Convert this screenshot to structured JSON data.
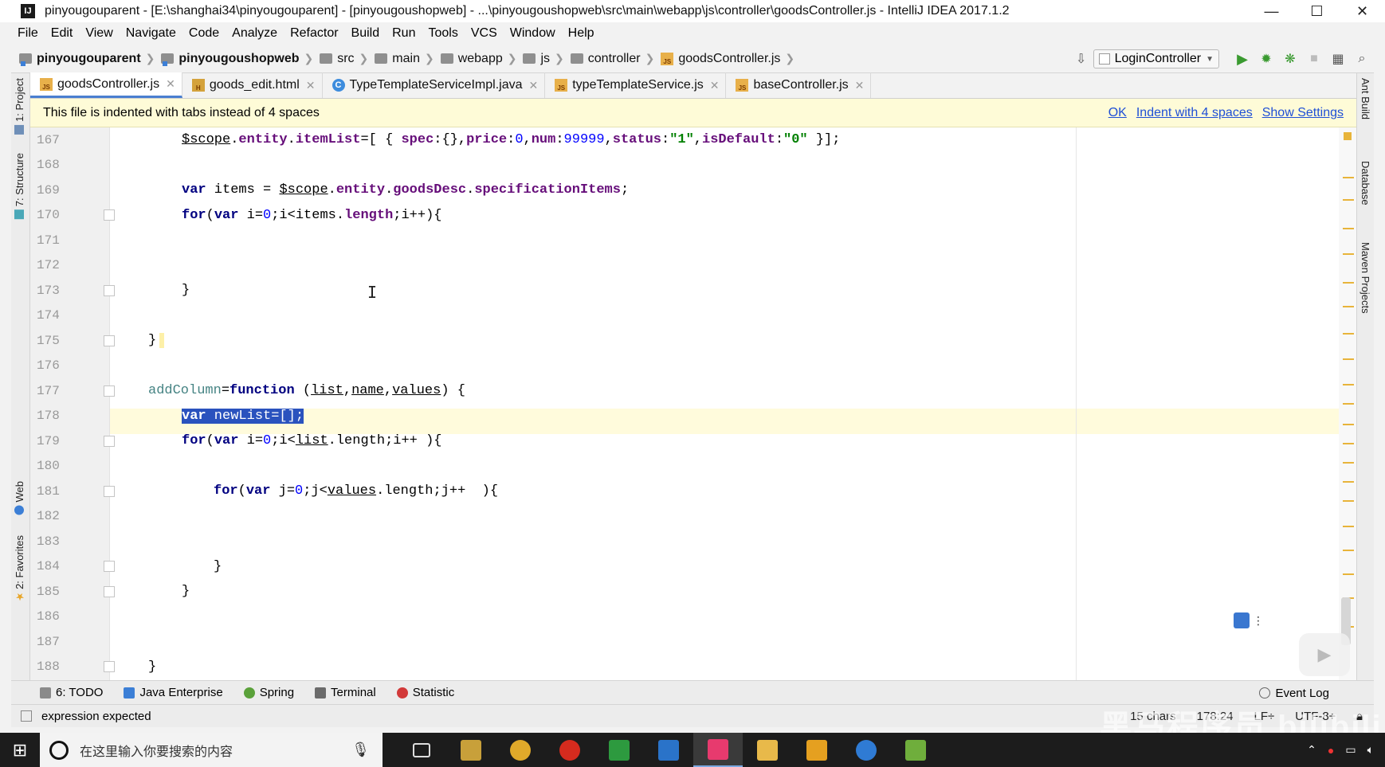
{
  "window": {
    "title": "pinyougouparent - [E:\\shanghai34\\pinyougouparent] - [pinyougoushopweb] - ...\\pinyougoushopweb\\src\\main\\webapp\\js\\controller\\goodsController.js - IntelliJ IDEA 2017.1.2",
    "app_icon": "IJ",
    "controls": {
      "minimize": "—",
      "maximize": "☐",
      "close": "✕"
    }
  },
  "menu": [
    "File",
    "Edit",
    "View",
    "Navigate",
    "Code",
    "Analyze",
    "Refactor",
    "Build",
    "Run",
    "Tools",
    "VCS",
    "Window",
    "Help"
  ],
  "breadcrumbs": [
    {
      "label": "pinyougouparent",
      "bold": true,
      "icon": "module-folder-icon"
    },
    {
      "label": "pinyougoushopweb",
      "bold": true,
      "icon": "module-folder-icon"
    },
    {
      "label": "src",
      "bold": false,
      "icon": "folder-icon"
    },
    {
      "label": "main",
      "bold": false,
      "icon": "folder-icon"
    },
    {
      "label": "webapp",
      "bold": false,
      "icon": "folder-icon"
    },
    {
      "label": "js",
      "bold": false,
      "icon": "folder-icon"
    },
    {
      "label": "controller",
      "bold": false,
      "icon": "folder-icon"
    },
    {
      "label": "goodsController.js",
      "bold": false,
      "icon": "js-file-icon"
    }
  ],
  "toolbar": {
    "run_config": "LoginController",
    "icons": [
      "build-icon",
      "run-icon",
      "debug-icon",
      "coverage-icon",
      "stop-icon",
      "project-structure-icon",
      "search-icon"
    ]
  },
  "left_tools": [
    "1: Project",
    "7: Structure",
    "Web",
    "2: Favorites"
  ],
  "right_tools": [
    "Ant Build",
    "Database",
    "Maven Projects"
  ],
  "tabs": [
    {
      "label": "goodsController.js",
      "type": "js",
      "active": true
    },
    {
      "label": "goods_edit.html",
      "type": "html",
      "active": false
    },
    {
      "label": "TypeTemplateServiceImpl.java",
      "type": "class",
      "active": false
    },
    {
      "label": "typeTemplateService.js",
      "type": "js",
      "active": false
    },
    {
      "label": "baseController.js",
      "type": "js",
      "active": false
    }
  ],
  "banner": {
    "message": "This file is indented with tabs instead of 4 spaces",
    "ok": "OK",
    "indent": "Indent with 4 spaces",
    "settings": "Show Settings"
  },
  "editor": {
    "caret_line": 178,
    "lines": [
      167,
      168,
      169,
      170,
      171,
      172,
      173,
      174,
      175,
      176,
      177,
      178,
      179,
      180,
      181,
      182,
      183,
      184,
      185,
      186,
      187,
      188
    ],
    "code_tokens": {
      "l167": {
        "scope": "$scope",
        "dot1": ".",
        "entity": "entity",
        "dot2": ".",
        "itemList": "itemList",
        "eq": "=[ { ",
        "spec": "spec",
        "c1": ":{},",
        "price": "price",
        "c2": ":",
        "pv": "0",
        "c3": ",",
        "num": "num",
        "c4": ":",
        "nv": "99999",
        "c5": ",",
        "status": "status",
        "c6": ":",
        "sv": "\"1\"",
        "c7": ",",
        "isDefault": "isDefault",
        "c8": ":",
        "dv": "\"0\"",
        "end": " }];"
      },
      "l169": {
        "var": "var",
        "rest": " items = ",
        "scope": "$scope",
        "dot1": ".",
        "entity": "entity",
        "dot2": ".",
        "goodsDesc": "goodsDesc",
        "dot3": ".",
        "specs": "specificationItems",
        "end": ";"
      },
      "l170": {
        "for": "for",
        "p1": "(",
        "var": "var",
        "rest": " i=",
        "n": "0",
        "rest2": ";i<items.",
        "length": "length",
        "rest3": ";i++){"
      },
      "l173": "}",
      "l175": "}",
      "l177": {
        "name": "addColumn",
        "eq": "=",
        "fn": "function",
        "p1": " (",
        "list": "list",
        "c1": ",",
        "name2": "name",
        "c2": ",",
        "values": "values",
        "p2": ") {"
      },
      "l178": {
        "var": "var",
        "rest": " newList=[];"
      },
      "l179": {
        "for": "for",
        "p1": "(",
        "var": "var",
        "rest": " i=",
        "n": "0",
        "rest2": ";i<",
        "list": "list",
        "rest3": ".length;i++ ){"
      },
      "l181": {
        "for": "for",
        "p1": "(",
        "var": "var",
        "rest": " j=",
        "n": "0",
        "rest2": ";j<",
        "values": "values",
        "rest3": ".length;j++  ){"
      },
      "l184": "}",
      "l185": "}",
      "l188": "}"
    }
  },
  "tool_windows": [
    {
      "label": "6: TODO",
      "icon": "todo-icon",
      "color": "#8a8a8a"
    },
    {
      "label": "Java Enterprise",
      "icon": "java-enterprise-icon",
      "color": "#3c7fd6"
    },
    {
      "label": "Spring",
      "icon": "spring-icon",
      "color": "#5aa13a"
    },
    {
      "label": "Terminal",
      "icon": "terminal-icon",
      "color": "#6b6b6b"
    },
    {
      "label": "Statistic",
      "icon": "statistic-icon",
      "color": "#d23a3a"
    }
  ],
  "event_log": "Event Log",
  "status": {
    "message": "expression expected",
    "chars": "15 chars",
    "position": "178:24",
    "line_sep": "LF÷",
    "encoding": "UTF-8÷"
  },
  "watermark": "黑马程序员 bilibili",
  "taskbar": {
    "search_placeholder": "在这里输入你要搜索的内容",
    "apps": [
      {
        "name": "task-view-icon",
        "color": "#1c1c1c",
        "active": false
      },
      {
        "name": "app-icon-1",
        "color": "#c8a03a",
        "active": false
      },
      {
        "name": "chrome-icon",
        "color": "#e0a92a",
        "active": false
      },
      {
        "name": "app-icon-red",
        "color": "#d52b1e",
        "active": false
      },
      {
        "name": "app-icon-green",
        "color": "#2d9a3f",
        "active": false
      },
      {
        "name": "app-icon-blue",
        "color": "#2a73c9",
        "active": false
      },
      {
        "name": "intellij-icon",
        "color": "#e73a6e",
        "active": true
      },
      {
        "name": "explorer-icon",
        "color": "#e8b94a",
        "active": false
      },
      {
        "name": "pdf-icon",
        "color": "#e5a020",
        "active": false
      },
      {
        "name": "app-icon-arrow",
        "color": "#2f7bd4",
        "active": false
      },
      {
        "name": "notepad-icon",
        "color": "#6fae3c",
        "active": false
      }
    ]
  }
}
